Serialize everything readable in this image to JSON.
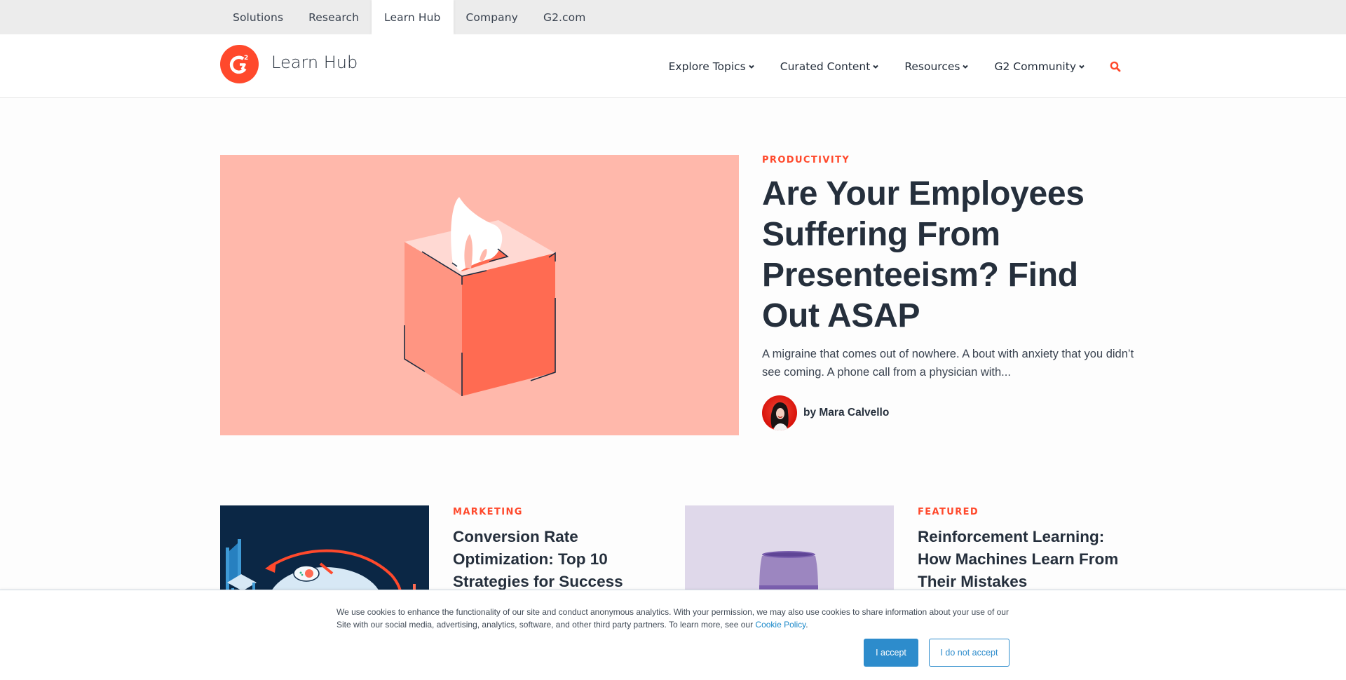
{
  "utility_nav": {
    "tabs": [
      {
        "label": "Solutions",
        "active": false
      },
      {
        "label": "Research",
        "active": false
      },
      {
        "label": "Learn Hub",
        "active": true
      },
      {
        "label": "Company",
        "active": false
      },
      {
        "label": "G2.com",
        "active": false
      }
    ]
  },
  "header": {
    "logo_icon": "g2-logo-icon",
    "brand_title": "Learn Hub",
    "nav": [
      {
        "label": "Explore Topics",
        "icon": "chevron-down-icon"
      },
      {
        "label": "Curated Content",
        "icon": "chevron-down-icon"
      },
      {
        "label": "Resources",
        "icon": "chevron-down-icon"
      },
      {
        "label": "G2 Community",
        "icon": "chevron-down-icon"
      }
    ],
    "search_icon": "search-icon",
    "accent_color": "#ff492c"
  },
  "hero": {
    "category": "PRODUCTIVITY",
    "title": "Are Your Employees Suffering From Presenteeism? Find Out ASAP",
    "excerpt": "A migraine that comes out of nowhere. A bout with anxiety that you didn’t see coming. A phone call from a physician with...",
    "author": "by Mara Calvello",
    "image_description": "tissue-box-illustration",
    "image_bg": "#ffb8ab"
  },
  "cards": [
    {
      "category": "MARKETING",
      "title": "Conversion Rate Optimization: Top 10 Strategies for Success",
      "image_description": "table-and-chairs-illustration",
      "image_bg": "#0b2745"
    },
    {
      "category": "FEATURED",
      "title": "Reinforcement Learning: How Machines Learn From Their Mistakes",
      "image_description": "purple-jar-illustration",
      "image_bg": "#dfd8ea"
    }
  ],
  "cookie_banner": {
    "text": "We use cookies to enhance the functionality of our site and conduct anonymous analytics. With your permission, we may also use cookies to share information about your use of our Site with our social media, advertising, analytics, software, and other third party partners. To learn more, see our ",
    "link_label": "Cookie Policy",
    "text_end": ".",
    "accept_label": "I accept",
    "decline_label": "I do not accept"
  }
}
